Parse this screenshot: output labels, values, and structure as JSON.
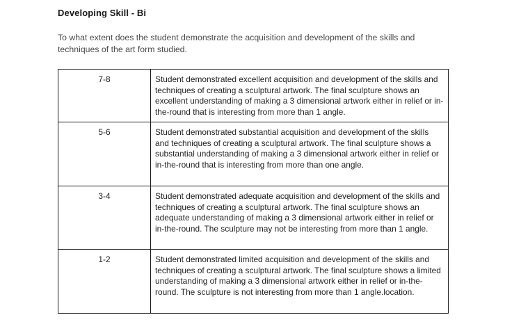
{
  "title": "Developing Skill - Bi",
  "intro": "To what extent does the student demonstrate the acquisition and development of the skills and techniques of the art form studied.",
  "rows": [
    {
      "score": "7-8",
      "description": "Student demonstrated excellent acquisition and development of the skills and techniques of creating a sculptural artwork. The final sculpture shows an excellent understanding of making a 3 dimensional artwork either in relief or in-the-round that is interesting from more than 1 angle."
    },
    {
      "score": "5-6",
      "description": "Student demonstrated substantial acquisition and development of the skills and techniques of creating a sculptural artwork. The final sculpture shows a substantial understanding of making a 3 dimensional artwork either in relief or in-the-round that is interesting from more than one angle."
    },
    {
      "score": "3-4",
      "description": "Student demonstrated adequate acquisition and development of the skills and techniques of creating a sculptural artwork. The final sculpture shows an adequate understanding of making a 3 dimensional artwork either in relief or in-the-round. The sculpture may not be interesting from more than 1 angle."
    },
    {
      "score": "1-2",
      "description": "Student demonstrated limited acquisition and development of the skills and techniques of creating a sculptural artwork. The final sculpture shows a limited understanding of making a 3 dimensional artwork either in relief or in-the-round. The sculpture is not interesting from more than 1 angle.location."
    }
  ]
}
